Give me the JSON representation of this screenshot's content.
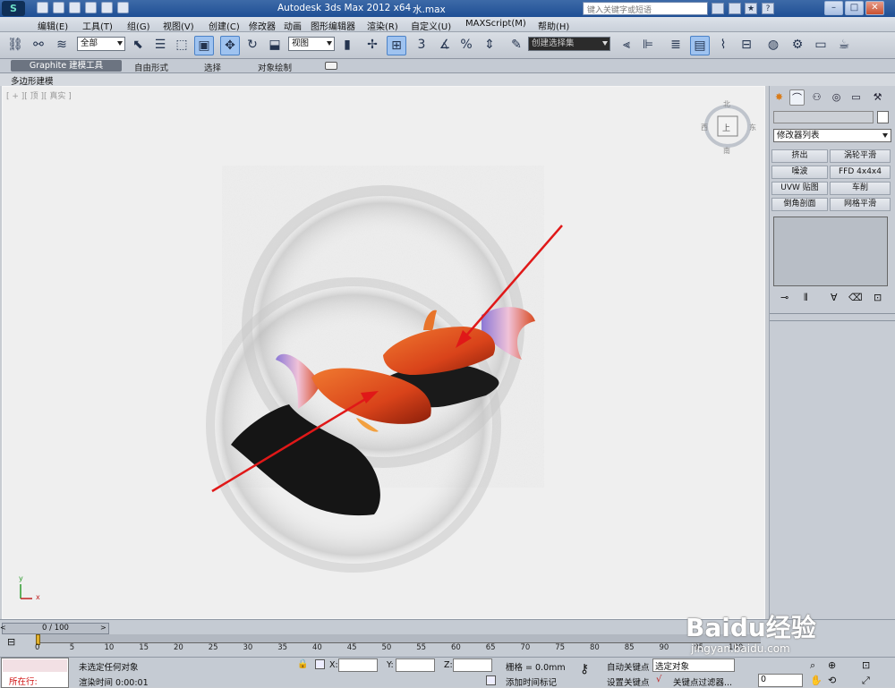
{
  "app": {
    "title": "Autodesk 3ds Max  2012 x64",
    "file": "水.max",
    "search_placeholder": "键入关键字或短语"
  },
  "window_buttons": [
    "–",
    "□",
    "✕"
  ],
  "menu": [
    "编辑(E)",
    "工具(T)",
    "组(G)",
    "视图(V)",
    "创建(C)",
    "修改器",
    "动画",
    "图形编辑器",
    "渲染(R)",
    "自定义(U)",
    "MAXScript(M)",
    "帮助(H)"
  ],
  "toolbar": {
    "selection_filter": "全部",
    "ref_coord": "视图",
    "named_selection": "创建选择集",
    "snap_text": "3",
    "percent_text": "%"
  },
  "ribbon": {
    "tabs": [
      "Graphite 建模工具",
      "自由形式",
      "选择",
      "对象绘制"
    ],
    "sub_tab": "多边形建模"
  },
  "viewport": {
    "label": "[ + ][ 顶 ][ 真实 ]",
    "viewcube_face": "上",
    "compass": {
      "n": "北",
      "s": "南",
      "e": "东",
      "w": "西"
    },
    "axis": {
      "x": "x",
      "y": "y"
    }
  },
  "command_panel": {
    "modifier_list": "修改器列表",
    "buttons": [
      "挤出",
      "涡轮平滑",
      "噪波",
      "FFD 4x4x4",
      "UVW 贴图",
      "车削",
      "倒角剖面",
      "网格平滑"
    ]
  },
  "timeline": {
    "frame_label": "0 / 100",
    "ticks": [
      "0",
      "5",
      "10",
      "15",
      "20",
      "25",
      "30",
      "35",
      "40",
      "45",
      "50",
      "55",
      "60",
      "65",
      "70",
      "75",
      "80",
      "85",
      "90",
      "95",
      "100"
    ]
  },
  "status": {
    "running": "所在行:",
    "prompt": "未选定任何对象",
    "render_time": "渲染时间  0:00:01",
    "x_label": "X:",
    "y_label": "Y:",
    "z_label": "Z:",
    "grid": "栅格 = 0.0mm",
    "add_time_tag": "添加时间标记",
    "auto_key": "自动关键点",
    "set_key": "设置关键点",
    "selected_object": "选定对象",
    "key_filters": "关键点过滤器...",
    "current_frame": "0"
  },
  "watermark": {
    "brand": "Baidu经验",
    "url": "jingyan.baidu.com"
  },
  "colors": {
    "arrow": "#e01818",
    "fish": "#e0501a",
    "titlebar": "#2a5a9e"
  }
}
